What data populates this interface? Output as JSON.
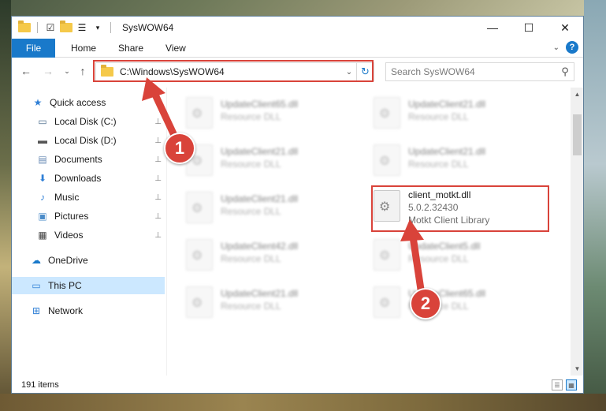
{
  "window": {
    "title": "SysWOW64",
    "controls": {
      "minimize": "—",
      "maximize": "☐",
      "close": "✕"
    }
  },
  "ribbon": {
    "tabs": [
      "File",
      "Home",
      "Share",
      "View"
    ],
    "expand_glyph": "⌄",
    "help_glyph": "?"
  },
  "nav": {
    "back": "←",
    "forward": "→",
    "recent": "⌄",
    "up": "↑"
  },
  "address": {
    "path": "C:\\Windows\\SysWOW64",
    "dropdown_glyph": "⌄",
    "refresh_glyph": "↻"
  },
  "search": {
    "placeholder": "Search SysWOW64",
    "icon_glyph": "⚲"
  },
  "sidebar": {
    "items": [
      {
        "label": "Quick access",
        "icon": "star-icon",
        "glyph": "★",
        "color": "#2f7fd6",
        "pinned": false
      },
      {
        "label": "Local Disk (C:)",
        "icon": "drive-icon",
        "glyph": "▭",
        "color": "#4b6c8c",
        "pinned": true
      },
      {
        "label": "Local Disk (D:)",
        "icon": "drive-icon",
        "glyph": "▬",
        "color": "#555555",
        "pinned": true
      },
      {
        "label": "Documents",
        "icon": "documents-icon",
        "glyph": "▤",
        "color": "#6a8bb5",
        "pinned": true
      },
      {
        "label": "Downloads",
        "icon": "downloads-icon",
        "glyph": "⬇",
        "color": "#2f7fd6",
        "pinned": true
      },
      {
        "label": "Music",
        "icon": "music-icon",
        "glyph": "♪",
        "color": "#2f7fd6",
        "pinned": true
      },
      {
        "label": "Pictures",
        "icon": "pictures-icon",
        "glyph": "▣",
        "color": "#4b8cc9",
        "pinned": true
      },
      {
        "label": "Videos",
        "icon": "videos-icon",
        "glyph": "▦",
        "color": "#444444",
        "pinned": true
      },
      {
        "label": "OneDrive",
        "icon": "onedrive-icon",
        "glyph": "☁",
        "color": "#1979ca",
        "pinned": false
      },
      {
        "label": "This PC",
        "icon": "computer-icon",
        "glyph": "▭",
        "color": "#2f7fd6",
        "pinned": false,
        "selected": true
      },
      {
        "label": "Network",
        "icon": "network-icon",
        "glyph": "⊞",
        "color": "#2f7fd6",
        "pinned": false
      }
    ],
    "pin_glyph": "📌"
  },
  "files": [
    {
      "name": "UpdateClient65.dll",
      "type": "Resource DLL",
      "blurred": true
    },
    {
      "name": "UpdateClient21.dll",
      "type": "Resource DLL",
      "blurred": true
    },
    {
      "name": "UpdateClient21.dll",
      "type": "Resource DLL",
      "blurred": true
    },
    {
      "name": "UpdateClient21.dll",
      "type": "Resource DLL",
      "blurred": true
    },
    {
      "name": "UpdateClient21.dll",
      "type": "Resource DLL",
      "blurred": true
    },
    {
      "name": "client_motkt.dll",
      "version": "5.0.2.32430",
      "type": "Motkt Client Library",
      "blurred": false
    },
    {
      "name": "UpdateClient42.dll",
      "type": "Resource DLL",
      "blurred": true
    },
    {
      "name": "UpdateClient5.dll",
      "type": "Resource DLL",
      "blurred": true
    },
    {
      "name": "UpdateClient21.dll",
      "type": "Resource DLL",
      "blurred": true
    },
    {
      "name": "UpdateClient65.dll",
      "type": "Resource DLL",
      "blurred": true
    }
  ],
  "status": {
    "item_count": "191 items"
  },
  "annotations": {
    "step1": "1",
    "step2": "2",
    "color": "#d9433a"
  }
}
